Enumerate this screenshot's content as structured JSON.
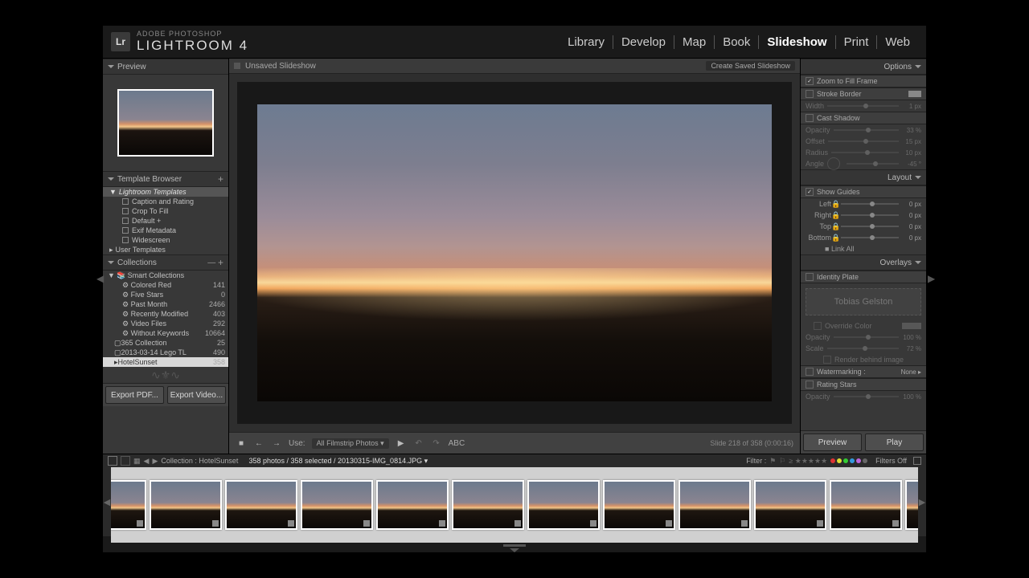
{
  "brand": {
    "small": "ADOBE PHOTOSHOP",
    "big": "LIGHTROOM 4",
    "logo": "Lr"
  },
  "modules": [
    "Library",
    "Develop",
    "Map",
    "Book",
    "Slideshow",
    "Print",
    "Web"
  ],
  "active_module": "Slideshow",
  "left": {
    "preview_hdr": "Preview",
    "template_hdr": "Template Browser",
    "templates_group": "Lightroom Templates",
    "templates": [
      "Caption and Rating",
      "Crop To Fill",
      "Default  +",
      "Exif Metadata",
      "Widescreen"
    ],
    "user_templates": "User Templates",
    "collections_hdr": "Collections",
    "smart_hdr": "Smart Collections",
    "smart": [
      {
        "n": "Colored Red",
        "c": "141"
      },
      {
        "n": "Five Stars",
        "c": "0"
      },
      {
        "n": "Past Month",
        "c": "2466"
      },
      {
        "n": "Recently Modified",
        "c": "403"
      },
      {
        "n": "Video Files",
        "c": "292"
      },
      {
        "n": "Without Keywords",
        "c": "10664"
      }
    ],
    "collections": [
      {
        "n": "365 Collection",
        "c": "25"
      },
      {
        "n": "2013-03-14 Lego TL",
        "c": "490"
      },
      {
        "n": "HotelSunset",
        "c": "358",
        "sel": true
      }
    ],
    "export_pdf": "Export PDF...",
    "export_video": "Export Video..."
  },
  "center": {
    "title": "Unsaved Slideshow",
    "create_saved": "Create Saved Slideshow",
    "use_label": "Use:",
    "use_value": "All Filmstrip Photos ▾",
    "abc": "ABC",
    "slide_info": "Slide 218 of 358 (0:00:16)"
  },
  "right": {
    "options_hdr": "Options",
    "zoom_fill": "Zoom to Fill Frame",
    "stroke_border": "Stroke Border",
    "width_lbl": "Width",
    "width_val": "1 px",
    "cast_shadow": "Cast Shadow",
    "shadow": [
      {
        "l": "Opacity",
        "v": "33 %"
      },
      {
        "l": "Offset",
        "v": "15 px"
      },
      {
        "l": "Radius",
        "v": "10 px"
      },
      {
        "l": "Angle",
        "v": "-45 °"
      }
    ],
    "layout_hdr": "Layout",
    "show_guides": "Show Guides",
    "guides": [
      {
        "l": "Left",
        "v": "0 px"
      },
      {
        "l": "Right",
        "v": "0 px"
      },
      {
        "l": "Top",
        "v": "0 px"
      },
      {
        "l": "Bottom",
        "v": "0 px"
      }
    ],
    "link_all": "Link All",
    "overlays_hdr": "Overlays",
    "identity_plate": "Identity Plate",
    "id_name": "Tobias Gelston",
    "override_color": "Override Color",
    "id_opacity_lbl": "Opacity",
    "id_opacity_val": "100 %",
    "id_scale_lbl": "Scale",
    "id_scale_val": "72 %",
    "render_behind": "Render behind image",
    "watermarking": "Watermarking :",
    "watermarking_val": "None ▸",
    "rating_stars": "Rating Stars",
    "rs_opacity_lbl": "Opacity",
    "rs_opacity_val": "100 %",
    "preview_btn": "Preview",
    "play_btn": "Play"
  },
  "strip": {
    "breadcrumb_label": "Collection : HotelSunset",
    "count": "358 photos / 358 selected / 20130315-IMG_0814.JPG ▾",
    "filter_lbl": "Filter :",
    "filters_off": "Filters Off",
    "colors": [
      "#d33",
      "#dd3",
      "#3c3",
      "#39d",
      "#b6d",
      "#666"
    ]
  }
}
